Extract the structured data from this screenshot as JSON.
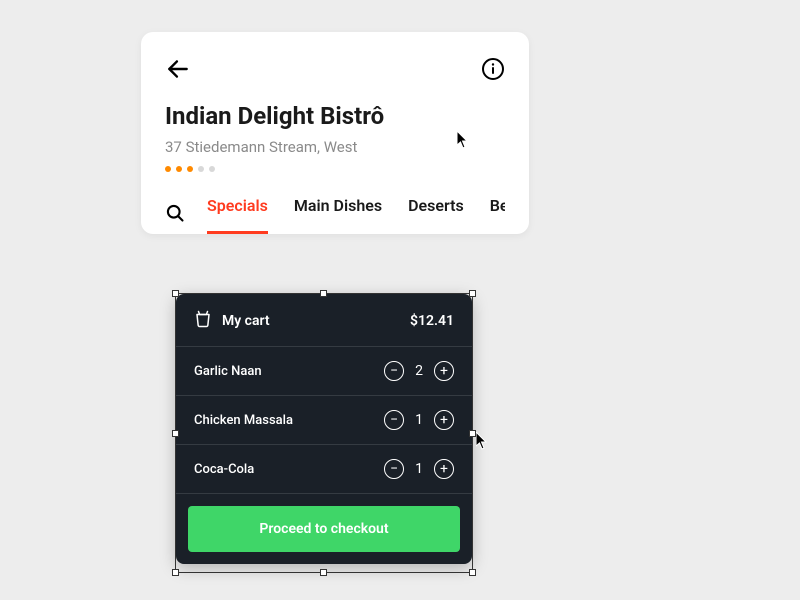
{
  "header": {
    "title": "Indian Delight Bistrô",
    "address": "37 Stiedemann Stream, West",
    "rating": 3,
    "rating_max": 5,
    "tabs": [
      {
        "label": "Specials",
        "active": true
      },
      {
        "label": "Main Dishes",
        "active": false
      },
      {
        "label": "Deserts",
        "active": false
      },
      {
        "label": "Beverages",
        "active": false
      }
    ]
  },
  "cart": {
    "title": "My cart",
    "total": "$12.41",
    "items": [
      {
        "name": "Garlic Naan",
        "qty": "2"
      },
      {
        "name": "Chicken Massala",
        "qty": "1"
      },
      {
        "name": "Coca-Cola",
        "qty": "1"
      }
    ],
    "checkout_label": "Proceed to checkout"
  }
}
